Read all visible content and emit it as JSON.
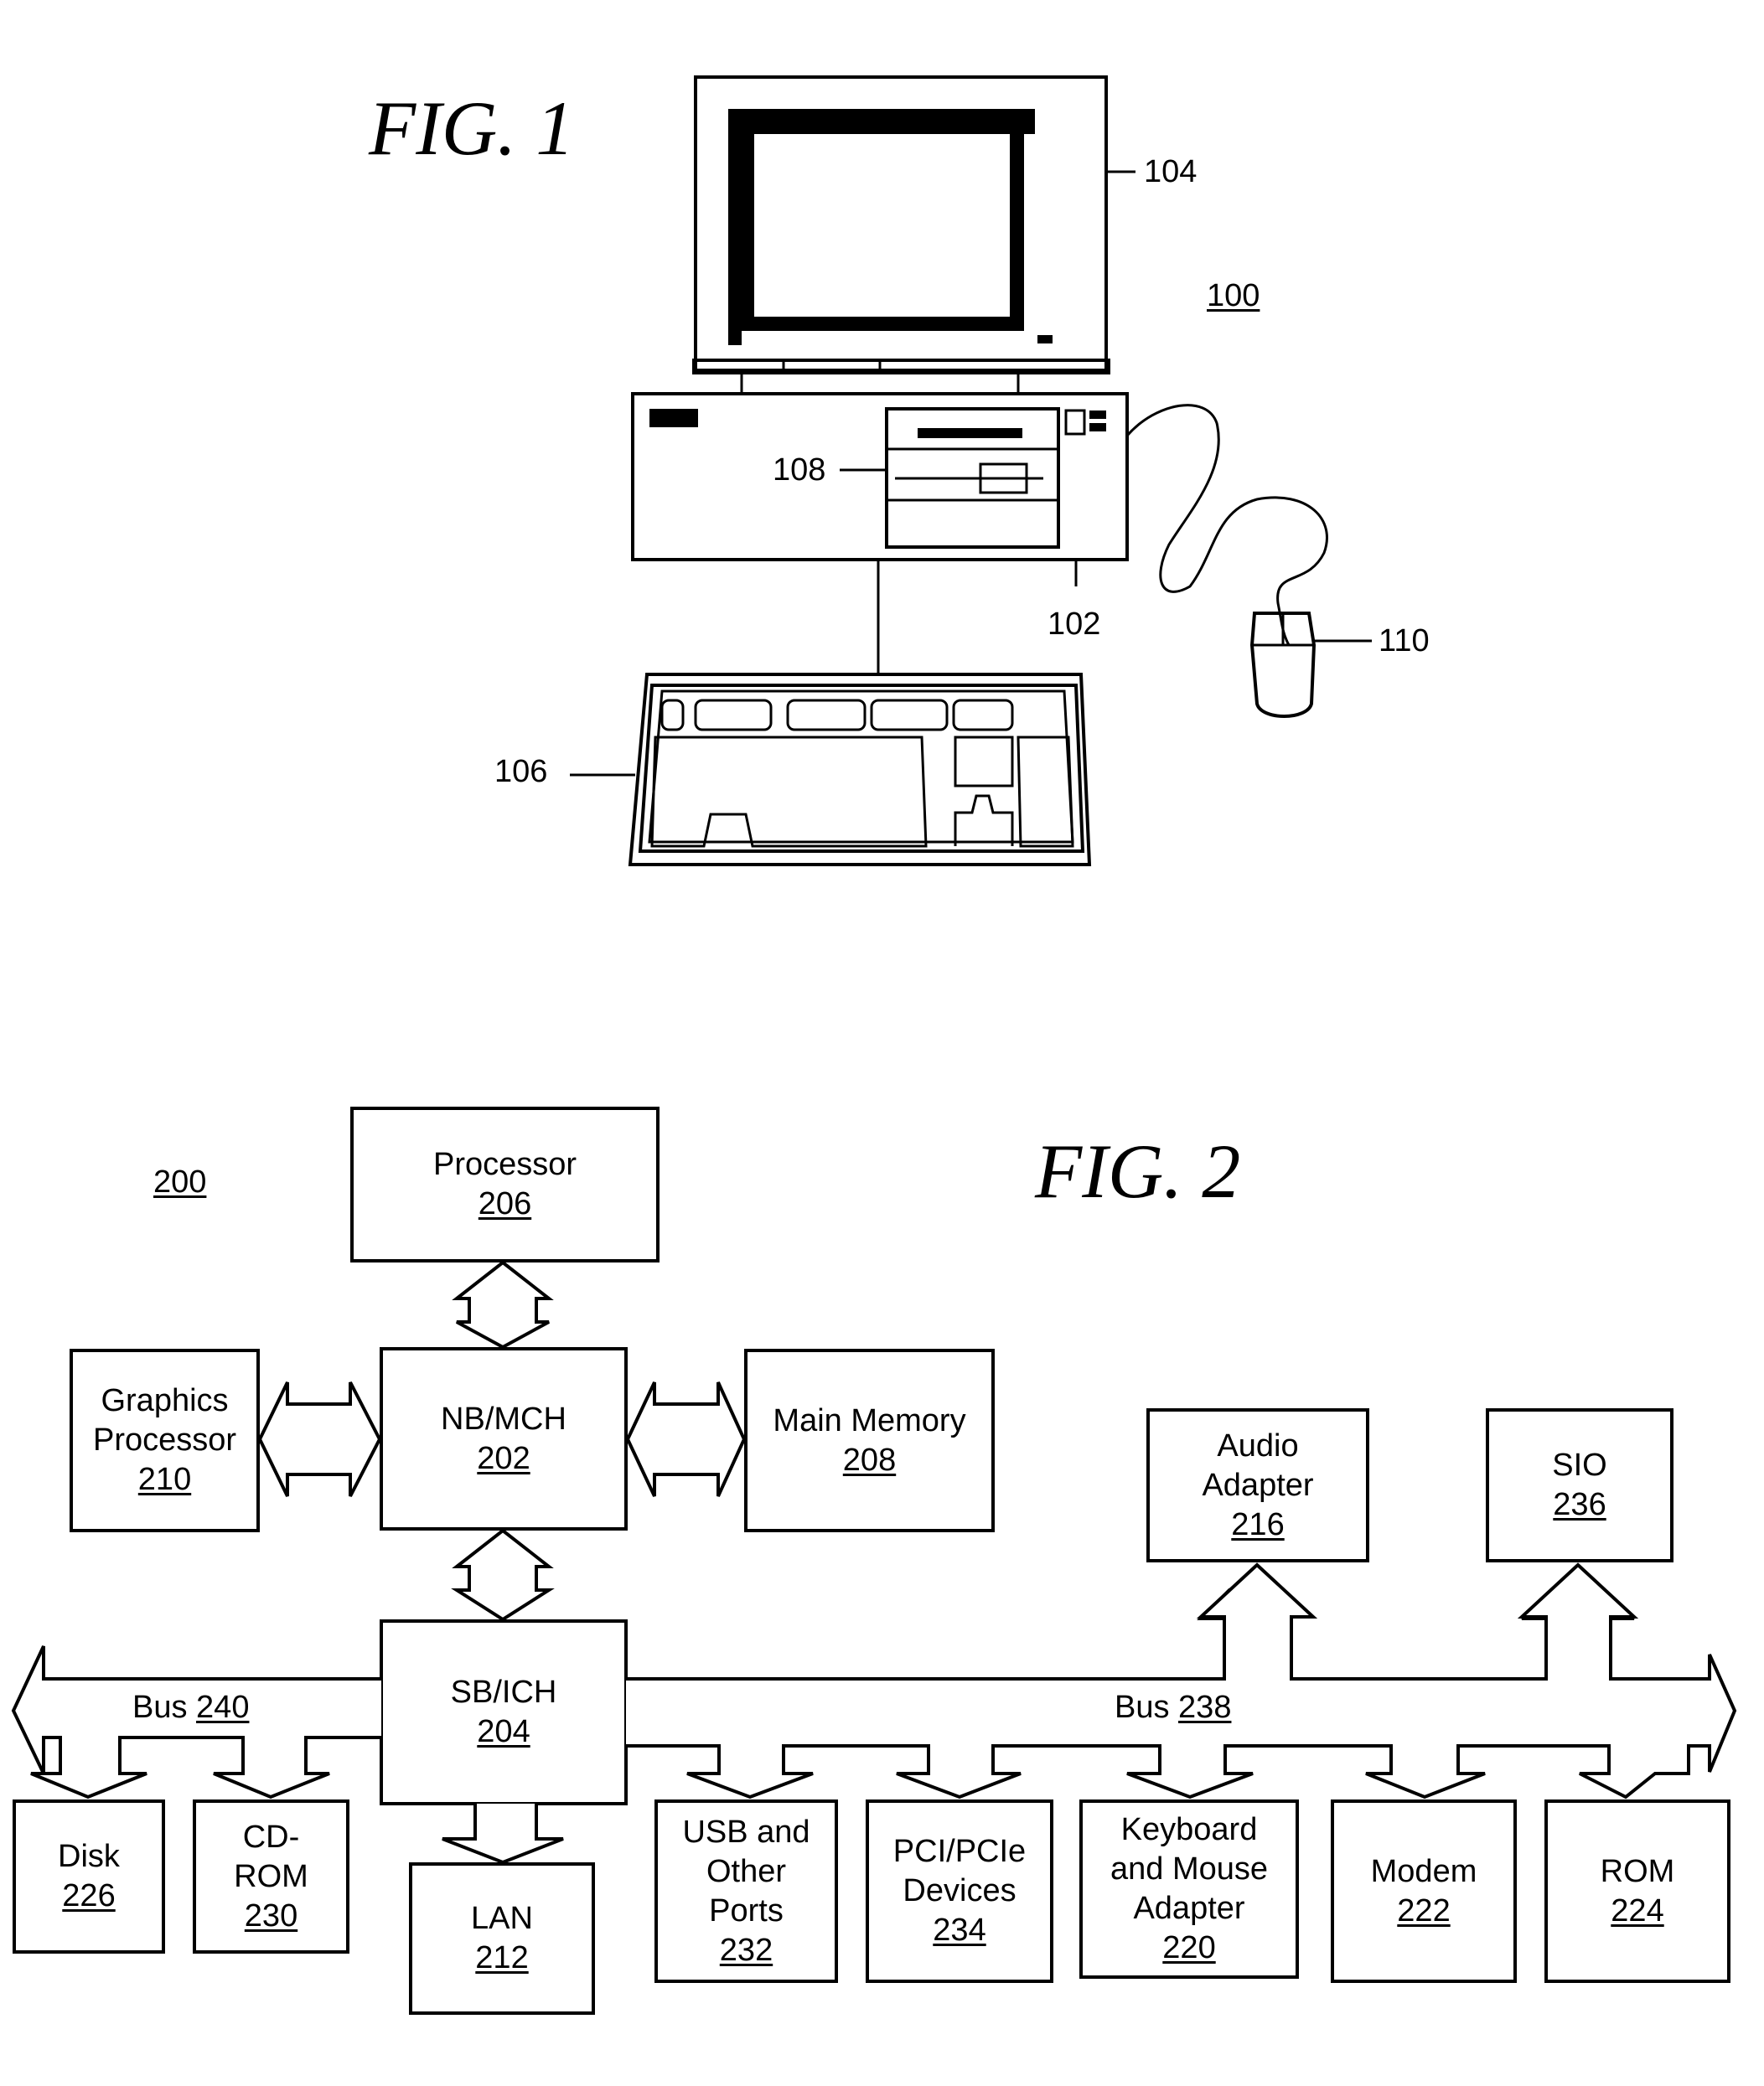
{
  "fig1": {
    "title": "FIG. 1",
    "system_ref": "100",
    "callouts": {
      "system_unit": "102",
      "monitor": "104",
      "keyboard": "106",
      "storage_drive": "108",
      "mouse": "110"
    }
  },
  "fig2": {
    "title": "FIG. 2",
    "system_ref": "200",
    "blocks": {
      "processor": {
        "lines": [
          "Processor"
        ],
        "ref": "206"
      },
      "nb_mch": {
        "lines": [
          "NB/MCH"
        ],
        "ref": "202"
      },
      "graphics": {
        "lines": [
          "Graphics",
          "Processor"
        ],
        "ref": "210"
      },
      "main_memory": {
        "lines": [
          "Main Memory"
        ],
        "ref": "208"
      },
      "sb_ich": {
        "lines": [
          "SB/ICH"
        ],
        "ref": "204"
      },
      "audio": {
        "lines": [
          "Audio",
          "Adapter"
        ],
        "ref": "216"
      },
      "sio": {
        "lines": [
          "SIO"
        ],
        "ref": "236"
      },
      "disk": {
        "lines": [
          "Disk"
        ],
        "ref": "226"
      },
      "cdrom": {
        "lines": [
          "CD-",
          "ROM"
        ],
        "ref": "230"
      },
      "lan": {
        "lines": [
          "LAN"
        ],
        "ref": "212"
      },
      "usb": {
        "lines": [
          "USB and",
          "Other",
          "Ports"
        ],
        "ref": "232"
      },
      "pci": {
        "lines": [
          "PCI/PCIe",
          "Devices"
        ],
        "ref": "234"
      },
      "kbd_mouse": {
        "lines": [
          "Keyboard",
          "and Mouse",
          "Adapter"
        ],
        "ref": "220"
      },
      "modem": {
        "lines": [
          "Modem"
        ],
        "ref": "222"
      },
      "rom": {
        "lines": [
          "ROM"
        ],
        "ref": "224"
      }
    },
    "buses": {
      "bus240": {
        "label": "Bus",
        "ref": "240"
      },
      "bus238": {
        "label": "Bus",
        "ref": "238"
      }
    }
  }
}
